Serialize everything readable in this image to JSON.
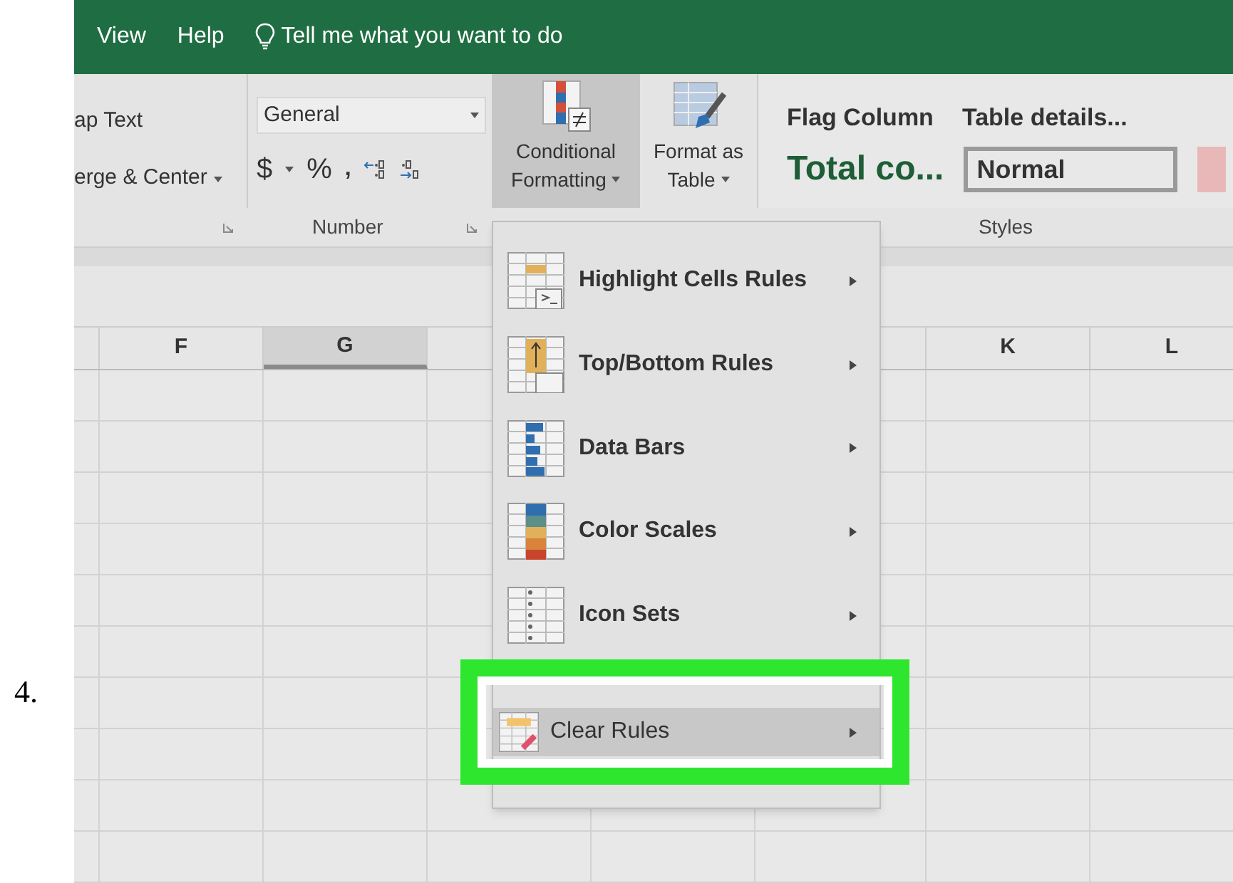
{
  "step_number": "4.",
  "tabs": [
    {
      "label": "View"
    },
    {
      "label": "Help"
    }
  ],
  "tell_me": "Tell me what you want to do",
  "alignment": {
    "wrap_text": "ap Text",
    "merge_center": "erge & Center"
  },
  "number": {
    "format": "General",
    "currency": "$",
    "percent": "%",
    "comma": ",",
    "group_label": "Number"
  },
  "conditional_formatting": {
    "line1": "Conditional",
    "line2": "Formatting",
    "selected": true
  },
  "format_as_table": {
    "line1": "Format as",
    "line2": "Table"
  },
  "styles": {
    "flag_column": "Flag Column",
    "table_details": "Table details...",
    "total": "Total co...",
    "normal": "Normal",
    "group_label": "Styles"
  },
  "columns_left": [
    {
      "label": "F",
      "selected": false
    },
    {
      "label": "G",
      "selected": true
    }
  ],
  "columns_right": [
    {
      "label": "K",
      "selected": false
    },
    {
      "label": "L",
      "selected": false
    }
  ],
  "menu": {
    "items": [
      {
        "label": "Highlight Cells Rules",
        "kind": "big",
        "selected": false
      },
      {
        "label": "Top/Bottom Rules",
        "kind": "big",
        "selected": false
      },
      {
        "label": "Data Bars",
        "kind": "big",
        "selected": false
      },
      {
        "label": "Color Scales",
        "kind": "big",
        "selected": false
      },
      {
        "label": "Icon Sets",
        "kind": "big",
        "selected": false
      },
      {
        "kind": "hidden",
        "selected": false
      },
      {
        "label": "Clear Rules",
        "kind": "small",
        "selected": true
      },
      {
        "kind": "hidden",
        "selected": false
      }
    ]
  }
}
